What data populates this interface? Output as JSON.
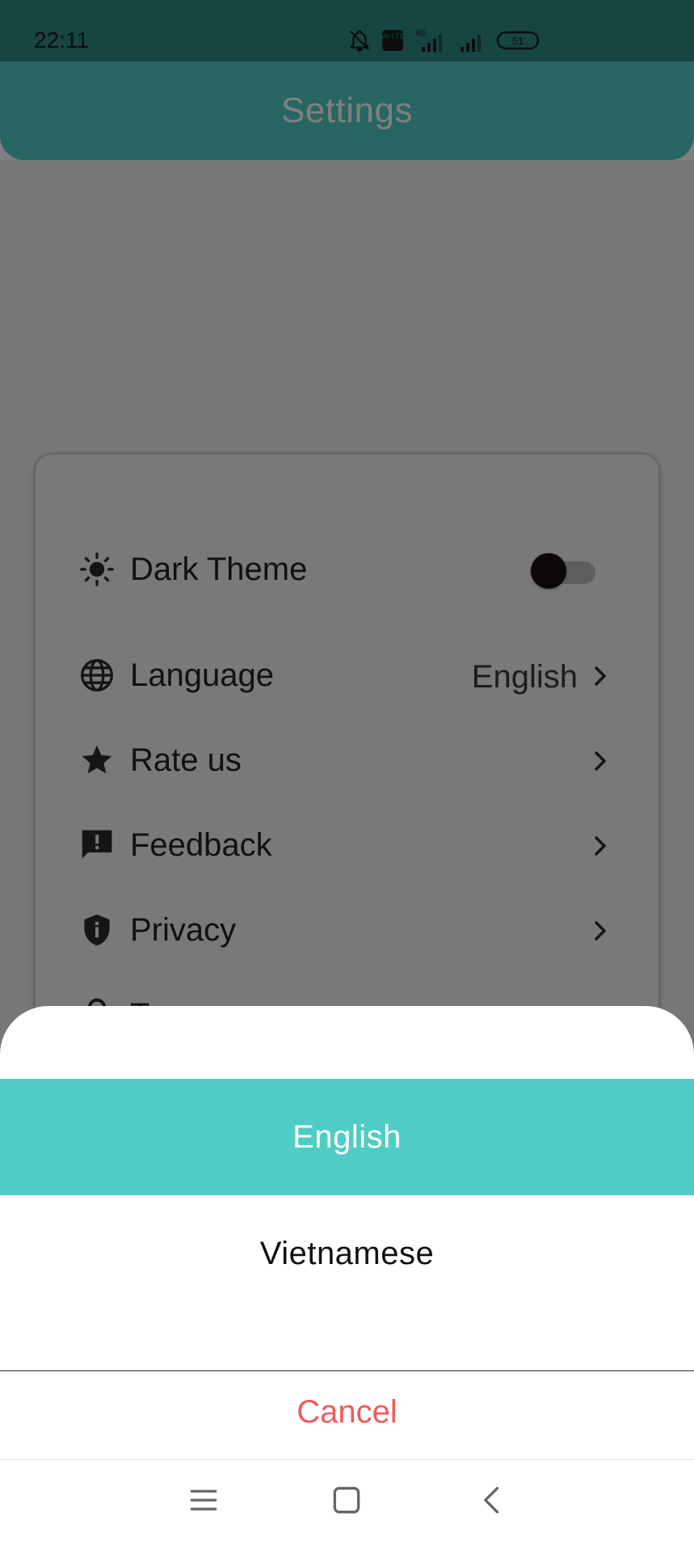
{
  "status_bar": {
    "time": "22:11",
    "icons": [
      "bell-off-icon",
      "volte-icon",
      "signal-4g-icon",
      "signal-icon",
      "battery-icon"
    ],
    "network_label": "4G",
    "volte_label": "Vo LTE",
    "battery_level": "51"
  },
  "app_bar": {
    "title": "Settings"
  },
  "settings": {
    "dark_theme": {
      "label": "Dark Theme",
      "icon": "sun-icon",
      "enabled": false
    },
    "language": {
      "label": "Language",
      "icon": "globe-icon",
      "value": "English"
    },
    "rate_us": {
      "label": "Rate us",
      "icon": "star-icon"
    },
    "feedback": {
      "label": "Feedback",
      "icon": "feedback-icon"
    },
    "privacy": {
      "label": "Privacy",
      "icon": "shield-icon"
    },
    "terms": {
      "label": "Terms",
      "icon": "lock-icon"
    }
  },
  "language_sheet": {
    "options": [
      "English",
      "Vietnamese"
    ],
    "selected": "English",
    "cancel_label": "Cancel"
  },
  "nav_bar": {
    "icons": [
      "menu-icon",
      "home-icon",
      "back-icon"
    ]
  },
  "colors": {
    "accent": "#4ecdc4",
    "cancel": "#ef5b5b",
    "status_bar": "#2f8a83"
  }
}
